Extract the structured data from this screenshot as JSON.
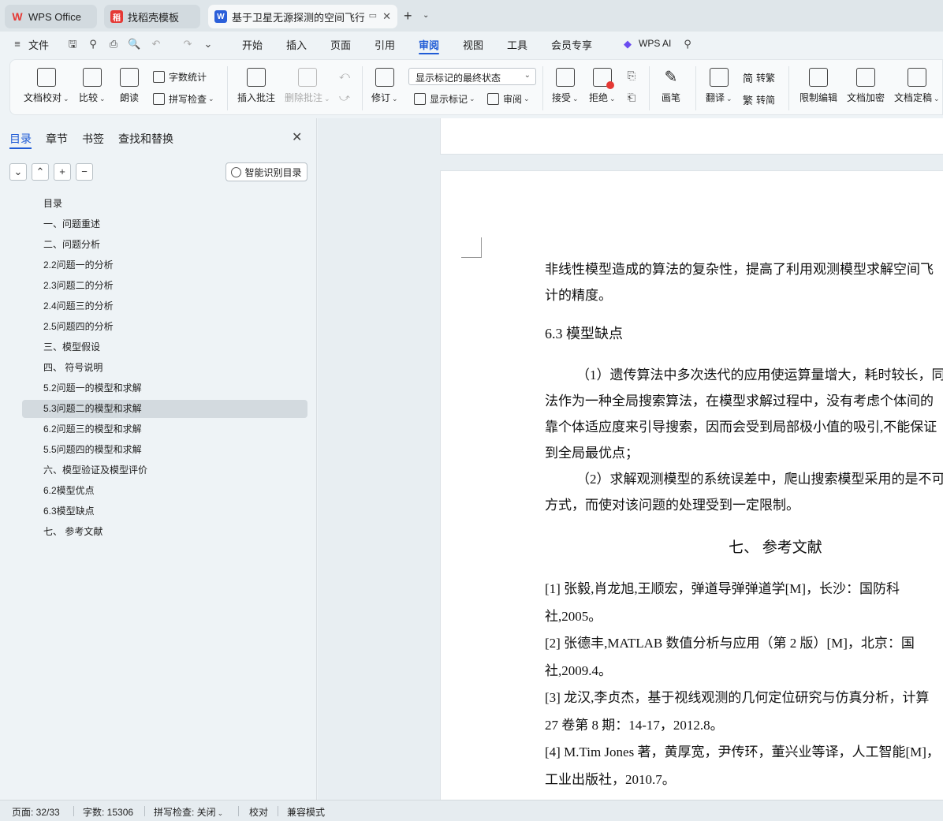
{
  "tabs": [
    {
      "label": "WPS Office",
      "icon": "wps-logo-icon",
      "color": "#e53935"
    },
    {
      "label": "找稻壳模板",
      "icon": "docer-icon",
      "color": "#e53935"
    },
    {
      "label": "基于卫星无源探测的空间飞行器",
      "icon": "word-doc-icon",
      "color": "#2b5fd9"
    }
  ],
  "menu": {
    "file": "文件",
    "items": [
      "开始",
      "插入",
      "页面",
      "引用",
      "审阅",
      "视图",
      "工具",
      "会员专享"
    ],
    "active": "审阅",
    "wps_ai": "WPS AI"
  },
  "ribbon": {
    "proofread": "文档校对",
    "compare": "比较",
    "read_aloud": "朗读",
    "word_count": "字数统计",
    "spell_check": "拼写检查",
    "insert_comment": "插入批注",
    "delete_comment": "删除批注",
    "track_changes": "修订",
    "markup_state": "显示标记的最终状态",
    "show_markup": "显示标记",
    "review": "审阅",
    "accept": "接受",
    "reject": "拒绝",
    "pen": "画笔",
    "translate": "翻译",
    "to_traditional": "转繁",
    "to_simplified": "转简",
    "restrict_edit": "限制编辑",
    "encrypt": "文档加密",
    "finalize": "文档定稿"
  },
  "sidebar": {
    "tabs": [
      "目录",
      "章节",
      "书签",
      "查找和替换"
    ],
    "smart_toc": "智能识别目录",
    "toc": [
      "目录",
      "一、问题重述",
      "二、问题分析",
      "2.2问题一的分析",
      "2.3问题二的分析",
      "2.4问题三的分析",
      "2.5问题四的分析",
      "三、模型假设",
      "四、 符号说明",
      "5.2问题一的模型和求解",
      "5.3问题二的模型和求解",
      "6.2问题三的模型和求解",
      "5.5问题四的模型和求解",
      "六、模型验证及模型评价",
      "6.2模型优点",
      "6.3模型缺点",
      "七、 参考文献"
    ],
    "selected_index": 10
  },
  "document": {
    "lines": [
      "非线性模型造成的算法的复杂性，提高了利用观测模型求解空间飞",
      "计的精度。"
    ],
    "heading_63": "6.3  模型缺点",
    "para1": [
      "（1）遗传算法中多次迭代的应用使运算量增大，耗时较长，同",
      "法作为一种全局搜索算法，在模型求解过程中，没有考虑个体间的",
      "靠个体适应度来引导搜索，因而会受到局部极小值的吸引,不能保证",
      "到全局最优点；"
    ],
    "para2": [
      "（2）求解观测模型的系统误差中，爬山搜索模型采用的是不可",
      "方式，而使对该问题的处理受到一定限制。"
    ],
    "heading_7": "七、  参考文献",
    "refs": [
      "[1] 张毅,肖龙旭,王顺宏，弹道导弹弹道学[M]，长沙：国防科",
      "社,2005。",
      "[2] 张德丰,MATLAB 数值分析与应用（第 2 版）[M]，北京：国",
      "社,2009.4。",
      "[3] 龙汉,李贞杰，基于视线观测的几何定位研究与仿真分析，计算",
      "27 卷第 8 期：14-17，2012.8。",
      "[4] M.Tim Jones 著，黄厚宽，尹传环，董兴业等译，人工智能[M]，",
      "工业出版社，2010.7。"
    ]
  },
  "status": {
    "page": "页面: 32/33",
    "words": "字数: 15306",
    "spell": "拼写检查: 关闭",
    "proof": "校对",
    "compat": "兼容模式"
  }
}
